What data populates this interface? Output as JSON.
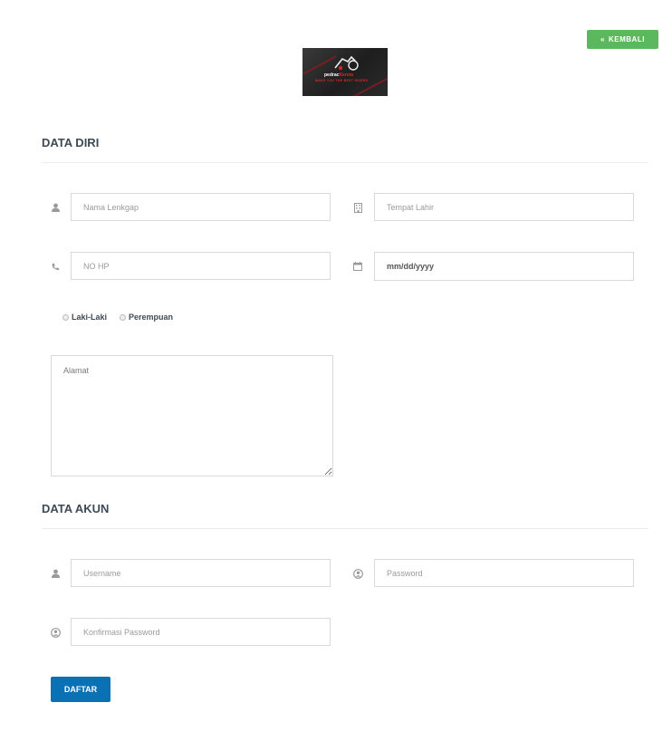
{
  "header": {
    "back_label": "KEMBALI",
    "back_icon": "double-chevron-left-icon",
    "logo_brand_white": "pedrac",
    "logo_brand_red": "Kereta",
    "logo_tagline": "MAKE YOU THE BEST RIDERS"
  },
  "sections": {
    "personal_title": "DATA DIRI",
    "account_title": "DATA AKUN"
  },
  "personal": {
    "full_name_placeholder": "Nama Lenkgap",
    "birthplace_placeholder": "Tempat Lahir",
    "phone_placeholder": "NO HP",
    "birthdate_value": "mm/dd/yyyy",
    "gender_options": [
      "Laki-Laki",
      "Perempuan"
    ],
    "address_placeholder": "Alamat"
  },
  "account": {
    "username_placeholder": "Username",
    "password_placeholder": "Password",
    "confirm_password_placeholder": "Konfirmasi Password"
  },
  "actions": {
    "submit_label": "DAFTAR"
  },
  "colors": {
    "back_button": "#5cb85c",
    "submit_button": "#0a72b4",
    "heading": "#3e4a55"
  }
}
